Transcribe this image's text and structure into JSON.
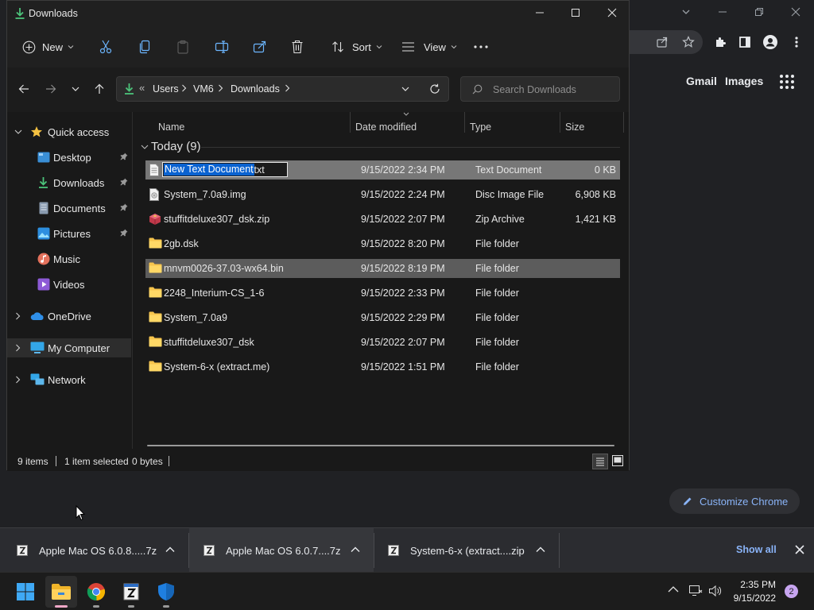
{
  "chrome": {
    "links": {
      "gmail": "Gmail",
      "images": "Images"
    },
    "customize_label": "Customize Chrome"
  },
  "explorer": {
    "title": "Downloads",
    "commands": {
      "new": "New",
      "sort": "Sort",
      "view": "View"
    },
    "breadcrumb": {
      "prefix": "«",
      "items": [
        "Users",
        "VM6",
        "Downloads"
      ]
    },
    "search_placeholder": "Search Downloads",
    "nav": {
      "quick_access": "Quick access",
      "desktop": "Desktop",
      "downloads": "Downloads",
      "documents": "Documents",
      "pictures": "Pictures",
      "music": "Music",
      "videos": "Videos",
      "onedrive": "OneDrive",
      "my_computer": "My Computer",
      "network": "Network"
    },
    "columns": {
      "name": "Name",
      "date": "Date modified",
      "type": "Type",
      "size": "Size"
    },
    "group_label": "Today (9)",
    "rename_value": "New Text Document",
    "rename_ext": ".txt",
    "files": [
      {
        "name": "New Text Document.txt",
        "date": "9/15/2022 2:34 PM",
        "type": "Text Document",
        "size": "0 KB"
      },
      {
        "name": "System_7.0a9.img",
        "date": "9/15/2022 2:24 PM",
        "type": "Disc Image File",
        "size": "6,908 KB"
      },
      {
        "name": "stuffitdeluxe307_dsk.zip",
        "date": "9/15/2022 2:07 PM",
        "type": "Zip Archive",
        "size": "1,421 KB"
      },
      {
        "name": "2gb.dsk",
        "date": "9/15/2022 8:20 PM",
        "type": "File folder",
        "size": ""
      },
      {
        "name": "mnvm0026-37.03-wx64.bin",
        "date": "9/15/2022 8:19 PM",
        "type": "File folder",
        "size": ""
      },
      {
        "name": "2248_Interium-CS_1-6",
        "date": "9/15/2022 2:33 PM",
        "type": "File folder",
        "size": ""
      },
      {
        "name": "System_7.0a9",
        "date": "9/15/2022 2:29 PM",
        "type": "File folder",
        "size": ""
      },
      {
        "name": "stuffitdeluxe307_dsk",
        "date": "9/15/2022 2:07 PM",
        "type": "File folder",
        "size": ""
      },
      {
        "name": "System-6-x (extract.me)",
        "date": "9/15/2022 1:51 PM",
        "type": "File folder",
        "size": ""
      }
    ],
    "status": {
      "items": "9 items",
      "selected": "1 item selected",
      "bytes": "0 bytes"
    }
  },
  "downloads_shelf": {
    "items": [
      "Apple Mac OS 6.0.8.....7z",
      "Apple Mac OS 6.0.7....7z",
      "System-6-x (extract....zip"
    ],
    "show_all": "Show all"
  },
  "taskbar": {
    "time": "2:35 PM",
    "date": "9/15/2022",
    "notification_count": "2"
  }
}
